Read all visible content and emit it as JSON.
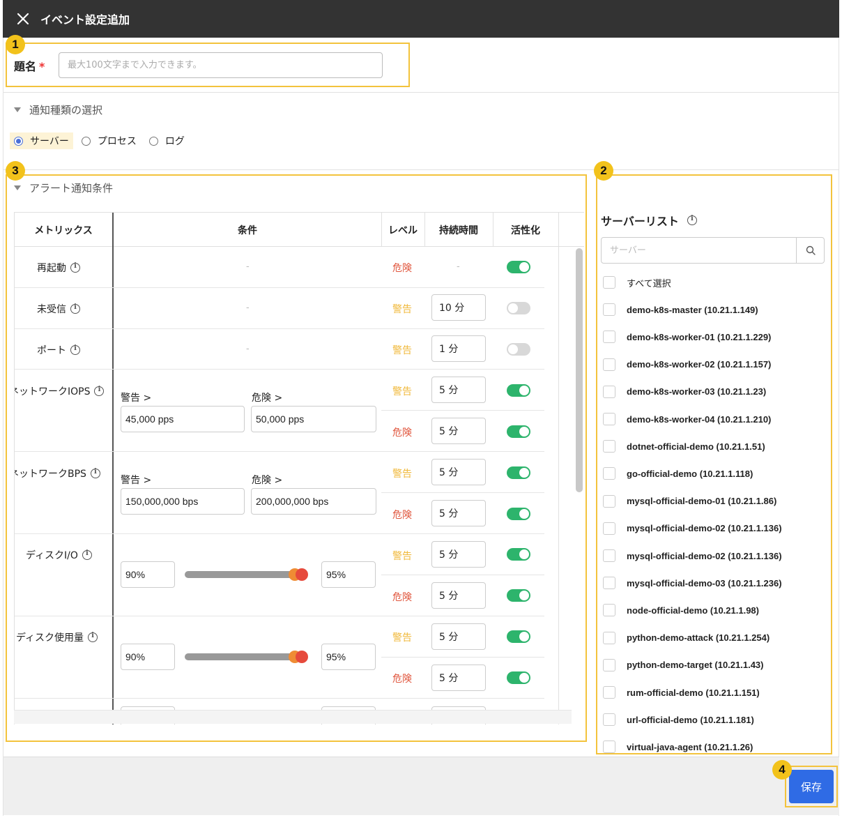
{
  "window": {
    "title": "イベント設定追加"
  },
  "subject": {
    "label": "題名",
    "required_mark": "*",
    "placeholder": "最大100文字まで入力できます。"
  },
  "notify_type": {
    "heading": "通知種類の選択",
    "options": [
      {
        "label": "サーバー",
        "selected": true
      },
      {
        "label": "プロセス",
        "selected": false
      },
      {
        "label": "ログ",
        "selected": false
      }
    ]
  },
  "alert": {
    "heading": "アラート通知条件",
    "columns": {
      "metrics": "メトリックス",
      "condition": "条件",
      "level": "レベル",
      "duration": "持続時間",
      "active": "活性化"
    },
    "dash": "-",
    "levels": {
      "danger": "危険",
      "warn": "警告"
    },
    "cond_labels": {
      "warn": "警告 >",
      "danger": "危険 >"
    },
    "rows": {
      "restart": {
        "name": "再起動",
        "level": "危険",
        "enabled": true
      },
      "not_received": {
        "name": "未受信",
        "level": "警告",
        "duration": "10 分",
        "enabled": false
      },
      "port": {
        "name": "ポート",
        "level": "警告",
        "duration": "1 分",
        "enabled": false
      },
      "net_iops": {
        "name": "ネットワークIOPS",
        "warn_value": "45,000 pps",
        "danger_value": "50,000 pps",
        "warn_duration": "5 分",
        "danger_duration": "5 分",
        "warn_enabled": true,
        "danger_enabled": true
      },
      "net_bps": {
        "name": "ネットワークBPS",
        "warn_value": "150,000,000 bps",
        "danger_value": "200,000,000 bps",
        "warn_duration": "5 分",
        "danger_duration": "5 分",
        "warn_enabled": true,
        "danger_enabled": true
      },
      "disk_io": {
        "name": "ディスクI/O",
        "low": "90%",
        "high": "95%",
        "warn_duration": "5 分",
        "danger_duration": "5 分",
        "warn_enabled": true,
        "danger_enabled": true
      },
      "disk_usage": {
        "name": "ディスク使用量",
        "low": "90%",
        "high": "95%",
        "warn_duration": "5 分",
        "danger_duration": "5 分",
        "warn_enabled": true,
        "danger_enabled": true
      }
    }
  },
  "server_list": {
    "title": "サーバーリスト",
    "search_placeholder": "サーバー",
    "select_all": "すべて選択",
    "servers": [
      "demo-k8s-master (10.21.1.149)",
      "demo-k8s-worker-01 (10.21.1.229)",
      "demo-k8s-worker-02 (10.21.1.157)",
      "demo-k8s-worker-03 (10.21.1.23)",
      "demo-k8s-worker-04 (10.21.1.210)",
      "dotnet-official-demo (10.21.1.51)",
      "go-official-demo (10.21.1.118)",
      "mysql-official-demo-01 (10.21.1.86)",
      "mysql-official-demo-02 (10.21.1.136)",
      "mysql-official-demo-02 (10.21.1.136)",
      "mysql-official-demo-03 (10.21.1.236)",
      "node-official-demo (10.21.1.98)",
      "python-demo-attack (10.21.1.254)",
      "python-demo-target (10.21.1.43)",
      "rum-official-demo (10.21.1.151)",
      "url-official-demo (10.21.1.181)",
      "virtual-java-agent (10.21.1.26)"
    ]
  },
  "footer": {
    "save_label": "保存"
  },
  "callouts": [
    "1",
    "2",
    "3",
    "4"
  ],
  "colors": {
    "accent_blue": "#2f6be5",
    "toggle_on": "#2db46c",
    "danger": "#e0553c",
    "warn": "#f0b93c",
    "callout": "#f2c21b"
  }
}
